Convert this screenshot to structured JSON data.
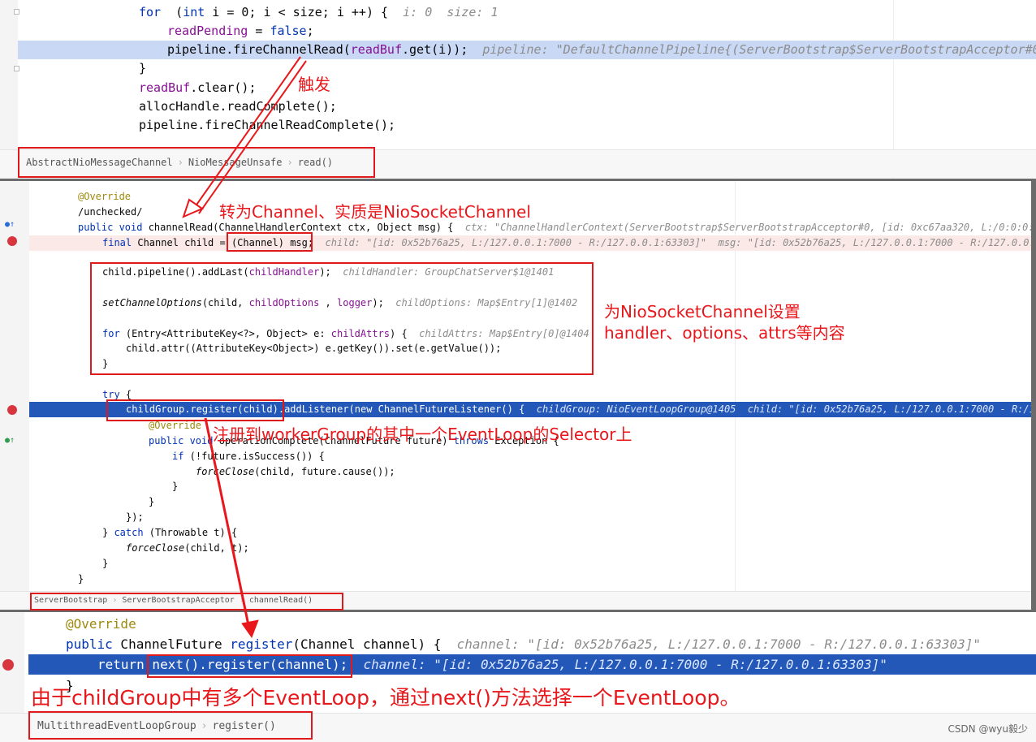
{
  "panel1": {
    "lines": [
      {
        "id": "p1l1",
        "parts": [
          [
            "kw",
            "for"
          ],
          [
            "",
            "  ("
          ],
          [
            "kw",
            "int"
          ],
          [
            "",
            " i = 0; i < size; i ++) {  "
          ],
          [
            "hint",
            "i: 0  size: 1"
          ]
        ]
      },
      {
        "id": "p1l2",
        "parts": [
          [
            "fld",
            "readPending"
          ],
          [
            "",
            " = "
          ],
          [
            "kw",
            "false"
          ],
          [
            "",
            ";"
          ]
        ]
      },
      {
        "id": "p1l3",
        "parts": [
          [
            "",
            "pipeline.fireChannelRead("
          ],
          [
            "fld",
            "readBuf"
          ],
          [
            "",
            ".get(i));  "
          ],
          [
            "hint",
            "pipeline: \"DefaultChannelPipeline{(ServerBootstrap$ServerBootstrapAcceptor#0"
          ]
        ]
      },
      {
        "id": "p1l4",
        "parts": [
          [
            "",
            "}"
          ]
        ]
      },
      {
        "id": "p1l5",
        "parts": [
          [
            "fld",
            "readBuf"
          ],
          [
            "",
            ".clear();"
          ]
        ]
      },
      {
        "id": "p1l6",
        "parts": [
          [
            "",
            "allocHandle.readComplete();"
          ]
        ]
      },
      {
        "id": "p1l7",
        "parts": [
          [
            "",
            "pipeline.fireChannelReadComplete();"
          ]
        ]
      }
    ],
    "breadcrumb": [
      "AbstractNioMessageChannel",
      "NioMessageUnsafe",
      "read()"
    ]
  },
  "panel2": {
    "lines": [
      {
        "id": "p2l1",
        "parts": [
          [
            "ann",
            "@Override"
          ]
        ]
      },
      {
        "id": "p2l2",
        "parts": [
          [
            "",
            "/unchecked/"
          ]
        ]
      },
      {
        "id": "p2l3",
        "parts": [
          [
            "kw",
            "public void"
          ],
          [
            "",
            " channelRead(ChannelHandlerContext ctx, Object msg) {  "
          ],
          [
            "hint",
            "ctx: \"ChannelHandlerContext(ServerBootstrap$ServerBootstrapAcceptor#0, [id: 0xc67aa320, L:/0:0:0:"
          ]
        ]
      },
      {
        "id": "p2l4",
        "parts": [
          [
            "kw",
            "final"
          ],
          [
            "",
            " Channel child = (Channel) msg;  "
          ],
          [
            "hint",
            "child: \"[id: 0x52b76a25, L:/127.0.0.1:7000 - R:/127.0.0.1:63303]\"  msg: \"[id: 0x52b76a25, L:/127.0.0.1:7000 - R:/127.0.0."
          ]
        ]
      },
      {
        "id": "p2l5",
        "parts": [
          [
            "",
            "child.pipeline().addLast("
          ],
          [
            "fld",
            "childHandler"
          ],
          [
            "",
            ");  "
          ],
          [
            "hint",
            "childHandler: GroupChatServer$1@1401"
          ]
        ]
      },
      {
        "id": "p2l6",
        "parts": [
          [
            "it",
            "setChannelOptions"
          ],
          [
            "",
            "(child, "
          ],
          [
            "fld",
            "childOptions"
          ],
          [
            "",
            " , "
          ],
          [
            "fld",
            "logger"
          ],
          [
            "",
            ");  "
          ],
          [
            "hint",
            "childOptions: Map$Entry[1]@1402"
          ]
        ]
      },
      {
        "id": "p2l7",
        "parts": [
          [
            "kw",
            "for"
          ],
          [
            "",
            " (Entry<AttributeKey<?>, Object> e: "
          ],
          [
            "fld",
            "childAttrs"
          ],
          [
            "",
            ") {  "
          ],
          [
            "hint",
            "childAttrs: Map$Entry[0]@1404"
          ]
        ]
      },
      {
        "id": "p2l8",
        "parts": [
          [
            "",
            "child.attr((AttributeKey<Object>) e.getKey()).set(e.getValue());"
          ]
        ]
      },
      {
        "id": "p2l9",
        "parts": [
          [
            "",
            "}"
          ]
        ]
      },
      {
        "id": "p2l10",
        "parts": [
          [
            "kw",
            "try"
          ],
          [
            "",
            " {"
          ]
        ]
      },
      {
        "id": "p2l11",
        "parts": [
          [
            "fld",
            "childGroup"
          ],
          [
            "",
            ".register(child).addListener("
          ],
          [
            "kw",
            "new"
          ],
          [
            "",
            " ChannelFutureListener() {  "
          ],
          [
            "hint",
            "childGroup: NioEventLoopGroup@1405  child: \"[id: 0x52b76a25, L:/127.0.0.1:7000 - R:/1"
          ]
        ]
      },
      {
        "id": "p2l12",
        "parts": [
          [
            "ann",
            "@Override"
          ]
        ]
      },
      {
        "id": "p2l13",
        "parts": [
          [
            "kw",
            "public void"
          ],
          [
            "",
            " operationComplete(ChannelFuture future) "
          ],
          [
            "kw",
            "throws"
          ],
          [
            "",
            " Exception {"
          ]
        ]
      },
      {
        "id": "p2l14",
        "parts": [
          [
            "kw",
            "if"
          ],
          [
            "",
            " (!future.isSuccess()) {"
          ]
        ]
      },
      {
        "id": "p2l15",
        "parts": [
          [
            "it",
            "forceClose"
          ],
          [
            "",
            "(child, future.cause());"
          ]
        ]
      },
      {
        "id": "p2l16",
        "parts": [
          [
            "",
            "}"
          ]
        ]
      },
      {
        "id": "p2l17",
        "parts": [
          [
            "",
            "}"
          ]
        ]
      },
      {
        "id": "p2l18",
        "parts": [
          [
            "",
            "});"
          ]
        ]
      },
      {
        "id": "p2l19",
        "parts": [
          [
            "",
            "} "
          ],
          [
            "kw",
            "catch"
          ],
          [
            "",
            " (Throwable t) {"
          ]
        ]
      },
      {
        "id": "p2l20",
        "parts": [
          [
            "it",
            "forceClose"
          ],
          [
            "",
            "(child, t);"
          ]
        ]
      },
      {
        "id": "p2l21",
        "parts": [
          [
            "",
            "}"
          ]
        ]
      },
      {
        "id": "p2l22",
        "parts": [
          [
            "",
            "}"
          ]
        ]
      }
    ],
    "breadcrumb": [
      "ServerBootstrap",
      "ServerBootstrapAcceptor",
      "channelRead()"
    ]
  },
  "panel3": {
    "lines": [
      {
        "id": "p3l1",
        "parts": [
          [
            "ann",
            "@Override"
          ]
        ]
      },
      {
        "id": "p3l2",
        "parts": [
          [
            "kw",
            "public"
          ],
          [
            "",
            " ChannelFuture "
          ],
          [
            "kw",
            "register"
          ],
          [
            "",
            "(Channel channel) {  "
          ],
          [
            "hint",
            "channel: \"[id: 0x52b76a25, L:/127.0.0.1:7000 - R:/127.0.0.1:63303]\""
          ]
        ]
      },
      {
        "id": "p3l3",
        "parts": [
          [
            "kw",
            "return"
          ],
          [
            "",
            " next().register(channel);  "
          ],
          [
            "hint",
            "channel: \"[id: 0x52b76a25, L:/127.0.0.1:7000 - R:/127.0.0.1:63303]\""
          ]
        ]
      },
      {
        "id": "p3l4",
        "parts": [
          [
            "",
            "}"
          ]
        ]
      }
    ],
    "breadcrumb": [
      "MultithreadEventLoopGroup",
      "register()"
    ]
  },
  "notes": {
    "trigger": "触发",
    "cast": "转为Channel、实质是NioSocketChannel",
    "setup_line1": "为NioSocketChannel设置",
    "setup_line2": "handler、options、attrs等内容",
    "register": "注册到workerGroup的其中一个EventLoop的Selector上",
    "next": "由于childGroup中有多个EventLoop，通过next()方法选择一个EventLoop。"
  },
  "watermark": "CSDN @wyu毅少",
  "colors": {
    "annotation_red": "#e8171b",
    "exec_line": "#2357b8",
    "keyword": "#0033b3",
    "field": "#871094"
  }
}
